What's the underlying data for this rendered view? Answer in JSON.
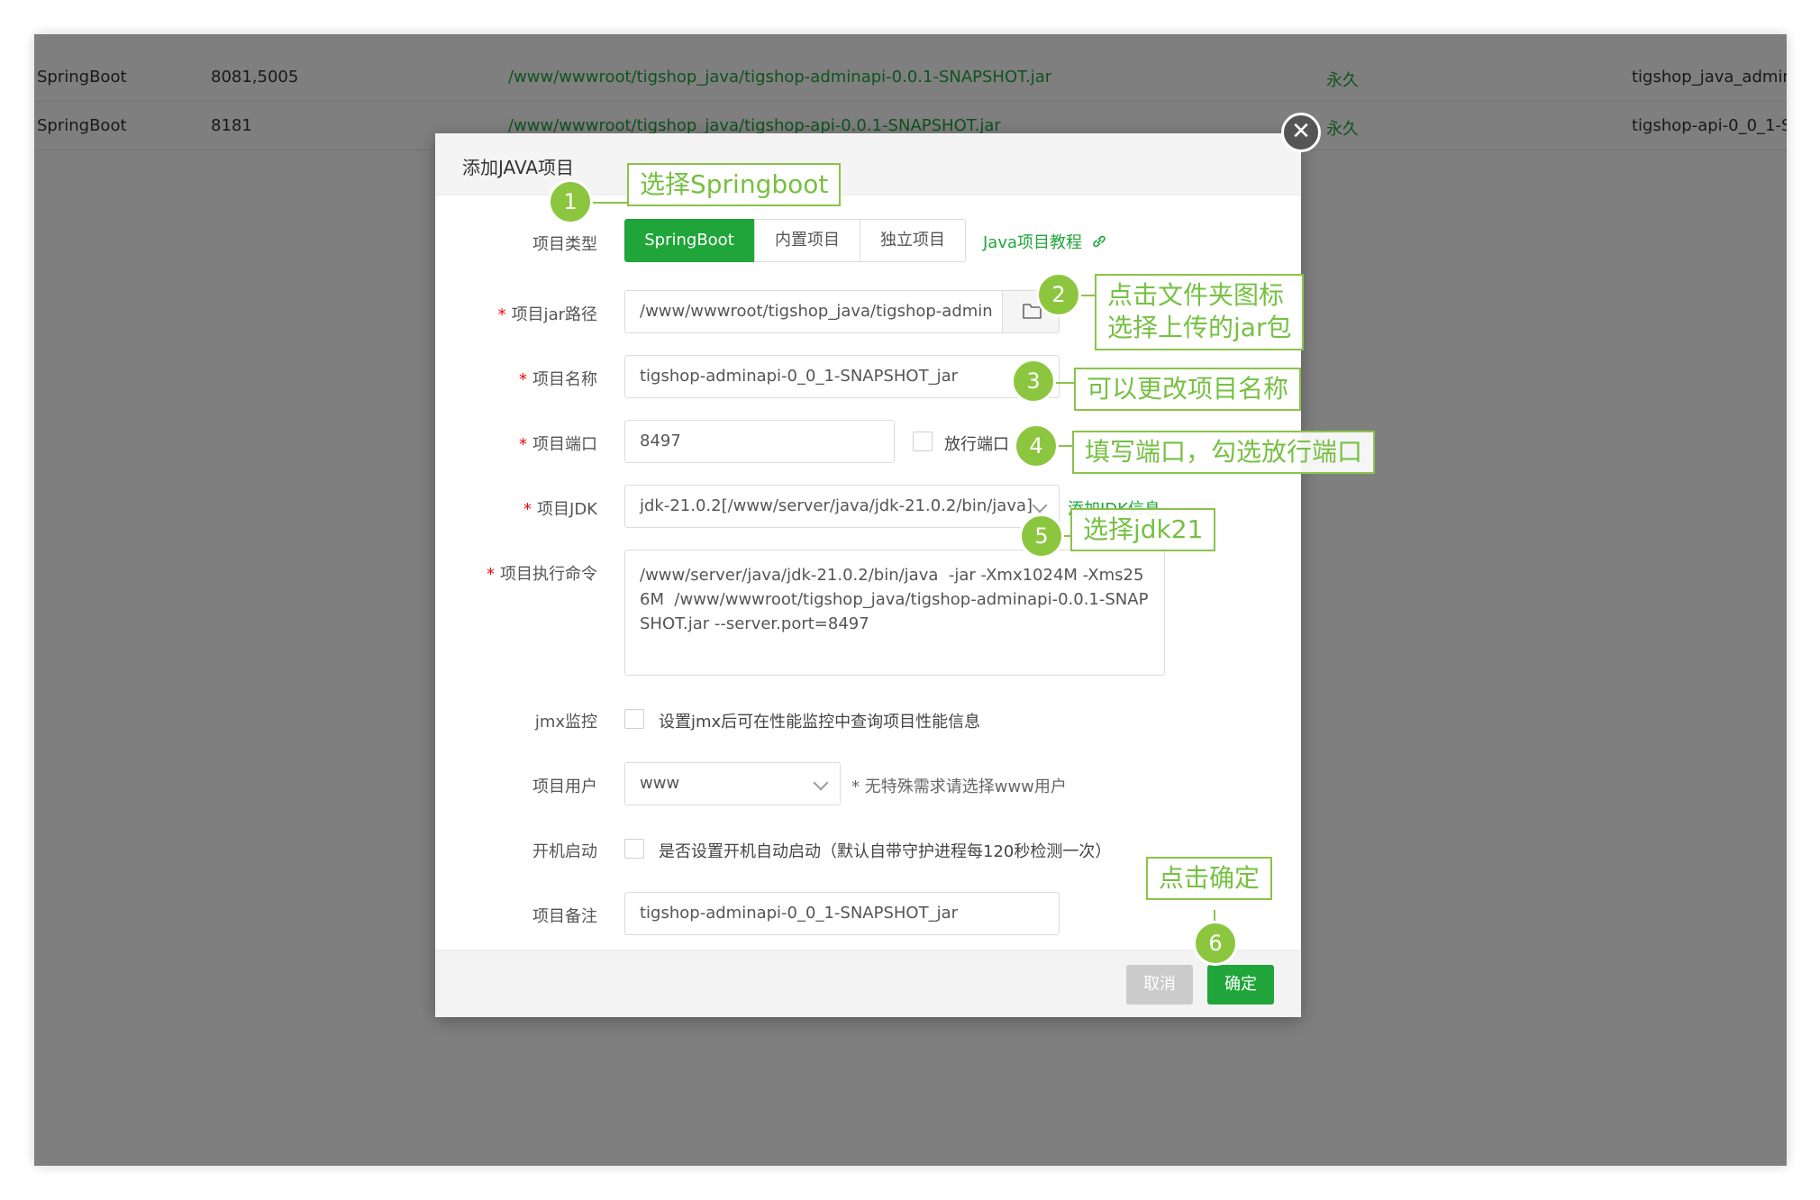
{
  "background_rows": [
    {
      "type": "SpringBoot",
      "ports": "8081,5005",
      "path": "/www/wwwroot/tigshop_java/tigshop-adminapi-0.0.1-SNAPSHOT.jar",
      "expire": "永久",
      "name": "tigshop_java_admina"
    },
    {
      "type": "SpringBoot",
      "ports": "8181",
      "path": "/www/wwwroot/tigshop_java/tigshop-api-0.0.1-SNAPSHOT.jar",
      "expire": "永久",
      "name": "tigshop-api-0_0_1-S"
    }
  ],
  "dialog": {
    "title": "添加JAVA项目",
    "close_icon": "✕",
    "project_type": {
      "label": "项目类型",
      "options": [
        "SpringBoot",
        "内置项目",
        "独立项目"
      ],
      "selected": "SpringBoot",
      "tutorial_link": "Java项目教程"
    },
    "jar_path": {
      "label": "项目jar路径",
      "value": "/www/wwwroot/tigshop_java/tigshop-admin"
    },
    "project_name": {
      "label": "项目名称",
      "value": "tigshop-adminapi-0_0_1-SNAPSHOT_jar"
    },
    "port": {
      "label": "项目端口",
      "value": "8497",
      "open_port_label": "放行端口"
    },
    "jdk": {
      "label": "项目JDK",
      "value": "jdk-21.0.2[/www/server/java/jdk-21.0.2/bin/java]",
      "add_link": "添加JDK信息"
    },
    "command": {
      "label": "项目执行命令",
      "value": "/www/server/java/jdk-21.0.2/bin/java  -jar -Xmx1024M -Xms256M  /www/wwwroot/tigshop_java/tigshop-adminapi-0.0.1-SNAPSHOT.jar --server.port=8497"
    },
    "jmx": {
      "label": "jmx监控",
      "checkbox_label": "设置jmx后可在性能监控中查询项目性能信息"
    },
    "user": {
      "label": "项目用户",
      "value": "www",
      "hint": "* 无特殊需求请选择www用户"
    },
    "autostart": {
      "label": "开机启动",
      "checkbox_label": "是否设置开机自动启动（默认自带守护进程每120秒检测一次）"
    },
    "remark": {
      "label": "项目备注",
      "value": "tigshop-adminapi-0_0_1-SNAPSHOT_jar"
    },
    "buttons": {
      "cancel": "取消",
      "ok": "确定"
    }
  },
  "annotations": {
    "step1": {
      "num": "1",
      "text": "选择Springboot"
    },
    "step2": {
      "num": "2",
      "line1": "点击文件夹图标",
      "line2": "选择上传的jar包"
    },
    "step3": {
      "num": "3",
      "text": "可以更改项目名称"
    },
    "step4": {
      "num": "4",
      "text": "填写端口，勾选放行端口"
    },
    "step5": {
      "num": "5",
      "text": "选择jdk21"
    },
    "step6": {
      "num": "6",
      "text": "点击确定"
    }
  },
  "colors": {
    "accent": "#20a53a",
    "annotation": "#8cc63f",
    "required": "#ef0808"
  }
}
